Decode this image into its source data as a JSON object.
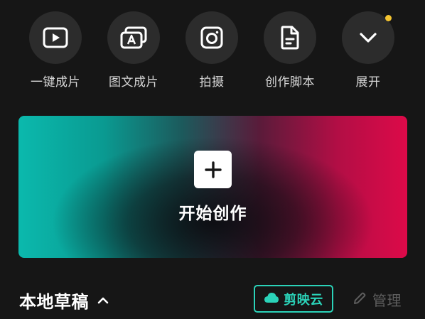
{
  "quick_actions": [
    {
      "label": "一键成片",
      "icon": "play-icon"
    },
    {
      "label": "图文成片",
      "icon": "text-image-icon"
    },
    {
      "label": "拍摄",
      "icon": "camera-icon"
    },
    {
      "label": "创作脚本",
      "icon": "script-icon"
    },
    {
      "label": "展开",
      "icon": "chevron-down-icon",
      "has_notification": true
    }
  ],
  "create": {
    "label": "开始创作",
    "icon": "plus-icon"
  },
  "drafts": {
    "title": "本地草稿",
    "toggle_icon": "chevron-up-icon",
    "cloud_button_label": "剪映云",
    "cloud_icon": "cloud-icon",
    "manage_label": "管理",
    "manage_icon": "pencil-icon"
  },
  "colors": {
    "background": "#161616",
    "accent": "#2bd3b9",
    "notification": "#f4c430",
    "banner_left": "#0bb9ad",
    "banner_right": "#dd0a49"
  }
}
